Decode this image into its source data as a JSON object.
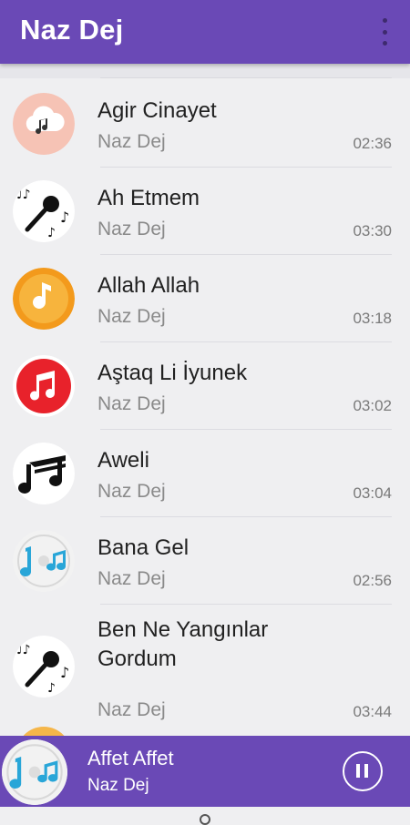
{
  "appbar": {
    "title": "Naz Dej",
    "menu_icon": "more-vert-icon"
  },
  "songs": [
    {
      "title": "Agir Cinayet",
      "artist": "Naz Dej",
      "duration": "02:36",
      "icon": "cloud-music-icon"
    },
    {
      "title": "Ah Etmem",
      "artist": "Naz Dej",
      "duration": "03:30",
      "icon": "microphone-notes-icon"
    },
    {
      "title": "Allah Allah",
      "artist": "Naz Dej",
      "duration": "03:18",
      "icon": "orange-music-note-icon"
    },
    {
      "title": "Aştaq Li İyunek",
      "artist": "Naz Dej",
      "duration": "03:02",
      "icon": "red-music-notes-icon"
    },
    {
      "title": "Aweli",
      "artist": "Naz Dej",
      "duration": "03:04",
      "icon": "black-music-notes-icon"
    },
    {
      "title": "Bana Gel",
      "artist": "Naz Dej",
      "duration": "02:56",
      "icon": "blue-music-notes-disc-icon"
    },
    {
      "title": "Ben Ne Yangınlar Gordum",
      "artist": "Naz Dej",
      "duration": "03:44",
      "icon": "microphone-notes-icon"
    }
  ],
  "player": {
    "title": "Affet Affet",
    "artist": "Naz Dej",
    "art_icon": "blue-music-notes-disc-icon",
    "control_icon": "pause-icon"
  },
  "colors": {
    "primary": "#6a49b6",
    "background": "#efeff1"
  }
}
